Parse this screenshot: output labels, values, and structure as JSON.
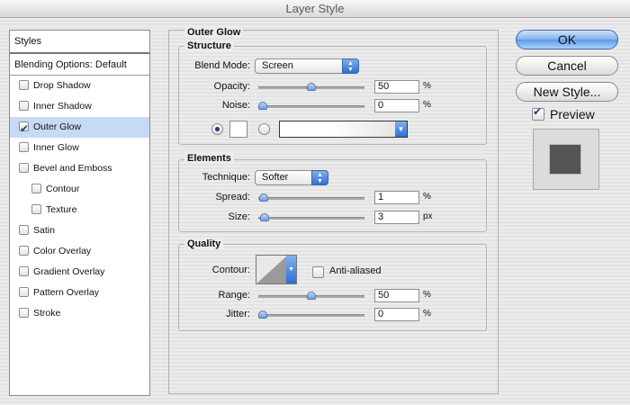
{
  "window": {
    "title": "Layer Style"
  },
  "styles_panel": {
    "header": "Styles",
    "blending_options": "Blending Options: Default",
    "items": [
      {
        "label": "Drop Shadow",
        "checked": false,
        "sub": false,
        "selected": false
      },
      {
        "label": "Inner Shadow",
        "checked": false,
        "sub": false,
        "selected": false
      },
      {
        "label": "Outer Glow",
        "checked": true,
        "sub": false,
        "selected": true
      },
      {
        "label": "Inner Glow",
        "checked": false,
        "sub": false,
        "selected": false
      },
      {
        "label": "Bevel and Emboss",
        "checked": false,
        "sub": false,
        "selected": false
      },
      {
        "label": "Contour",
        "checked": false,
        "sub": true,
        "selected": false
      },
      {
        "label": "Texture",
        "checked": false,
        "sub": true,
        "selected": false
      },
      {
        "label": "Satin",
        "checked": false,
        "sub": false,
        "selected": false
      },
      {
        "label": "Color Overlay",
        "checked": false,
        "sub": false,
        "selected": false
      },
      {
        "label": "Gradient Overlay",
        "checked": false,
        "sub": false,
        "selected": false
      },
      {
        "label": "Pattern Overlay",
        "checked": false,
        "sub": false,
        "selected": false
      },
      {
        "label": "Stroke",
        "checked": false,
        "sub": false,
        "selected": false
      }
    ]
  },
  "outer_glow": {
    "title": "Outer Glow",
    "structure": {
      "title": "Structure",
      "blend_mode_label": "Blend Mode:",
      "blend_mode": "Screen",
      "opacity_label": "Opacity:",
      "opacity": "50",
      "opacity_unit": "%",
      "opacity_level": 0.5,
      "noise_label": "Noise:",
      "noise": "0",
      "noise_unit": "%",
      "noise_level": 0.0,
      "color_mode": "solid",
      "glow_color": "#ffffff"
    },
    "elements": {
      "title": "Elements",
      "technique_label": "Technique:",
      "technique": "Softer",
      "spread_label": "Spread:",
      "spread": "1",
      "spread_unit": "%",
      "spread_level": 0.01,
      "size_label": "Size:",
      "size": "3",
      "size_unit": "px",
      "size_level": 0.015
    },
    "quality": {
      "title": "Quality",
      "contour_label": "Contour:",
      "anti_aliased_label": "Anti-aliased",
      "anti_aliased": false,
      "range_label": "Range:",
      "range": "50",
      "range_unit": "%",
      "range_level": 0.5,
      "jitter_label": "Jitter:",
      "jitter": "0",
      "jitter_unit": "%",
      "jitter_level": 0.0
    }
  },
  "buttons": {
    "ok": "OK",
    "cancel": "Cancel",
    "new_style": "New Style...",
    "preview_label": "Preview",
    "preview_checked": true
  },
  "colors": {
    "accent": "#5d9ae6",
    "selection": "#c6daf4",
    "preview_swatch": "#555555"
  }
}
